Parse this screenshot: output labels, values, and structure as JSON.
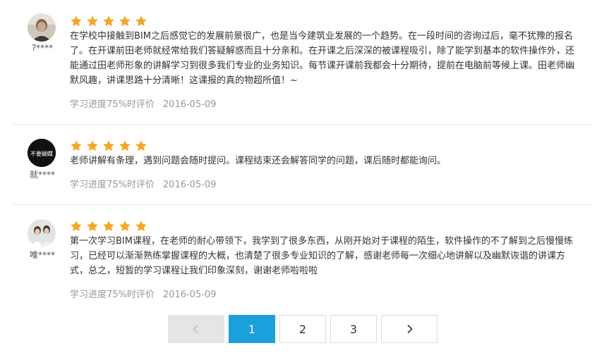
{
  "reviews": [
    {
      "username": "?****",
      "rating": 5,
      "text": "在学校中接触到BIM之后感觉它的发展前景很广，也是当今建筑业发展的一个趋势。在一段时间的咨询过后，毫不犹豫的报名了。在开课前田老师就经常给我们答疑解惑而且十分亲和。在开课之后深深的被课程吸引，除了能学到基本的软件操作外，还能通过田老师形象的讲解学习到很多我们专业的业务知识。每节课开课前我都会十分期待，提前在电脑前等候上课。田老师幽默风趣，讲课思路十分清晰！这课报的真的物超所值！~",
      "progress_label": "学习进度75%时评价",
      "date": "2016-05-09"
    },
    {
      "username": "就****",
      "rating": 5,
      "text": "老师讲解有条理，遇到问题会随时提问。课程结束还会解答同学的问题，课后随时都能询问。",
      "progress_label": "学习进度75%时评价",
      "date": "2016-05-09",
      "avatar_text": "不要蝴蝶"
    },
    {
      "username": "唯****",
      "rating": 5,
      "text": "第一次学习BIM课程，在老师的耐心带领下，我学到了很多东西，从刚开始对于课程的陌生，软件操作的不了解到之后慢慢练习，已经可以渐渐熟练掌握课程的大概，也清楚了很多专业知识的了解，感谢老师每一次细心地讲解以及幽默诙谐的讲课方式，总之，短暂的学习课程让我们印象深刻，谢谢老师啦啦啦",
      "progress_label": "学习进度75%时评价",
      "date": "2016-05-09"
    }
  ],
  "pagination": {
    "prev_icon": "chevron-left-icon",
    "next_icon": "chevron-right-icon",
    "pages": [
      "1",
      "2",
      "3"
    ],
    "current": "1"
  },
  "colors": {
    "star": "#f5a623",
    "active_page": "#1aa0dd",
    "meta_text": "#999999",
    "body_text": "#333333"
  }
}
